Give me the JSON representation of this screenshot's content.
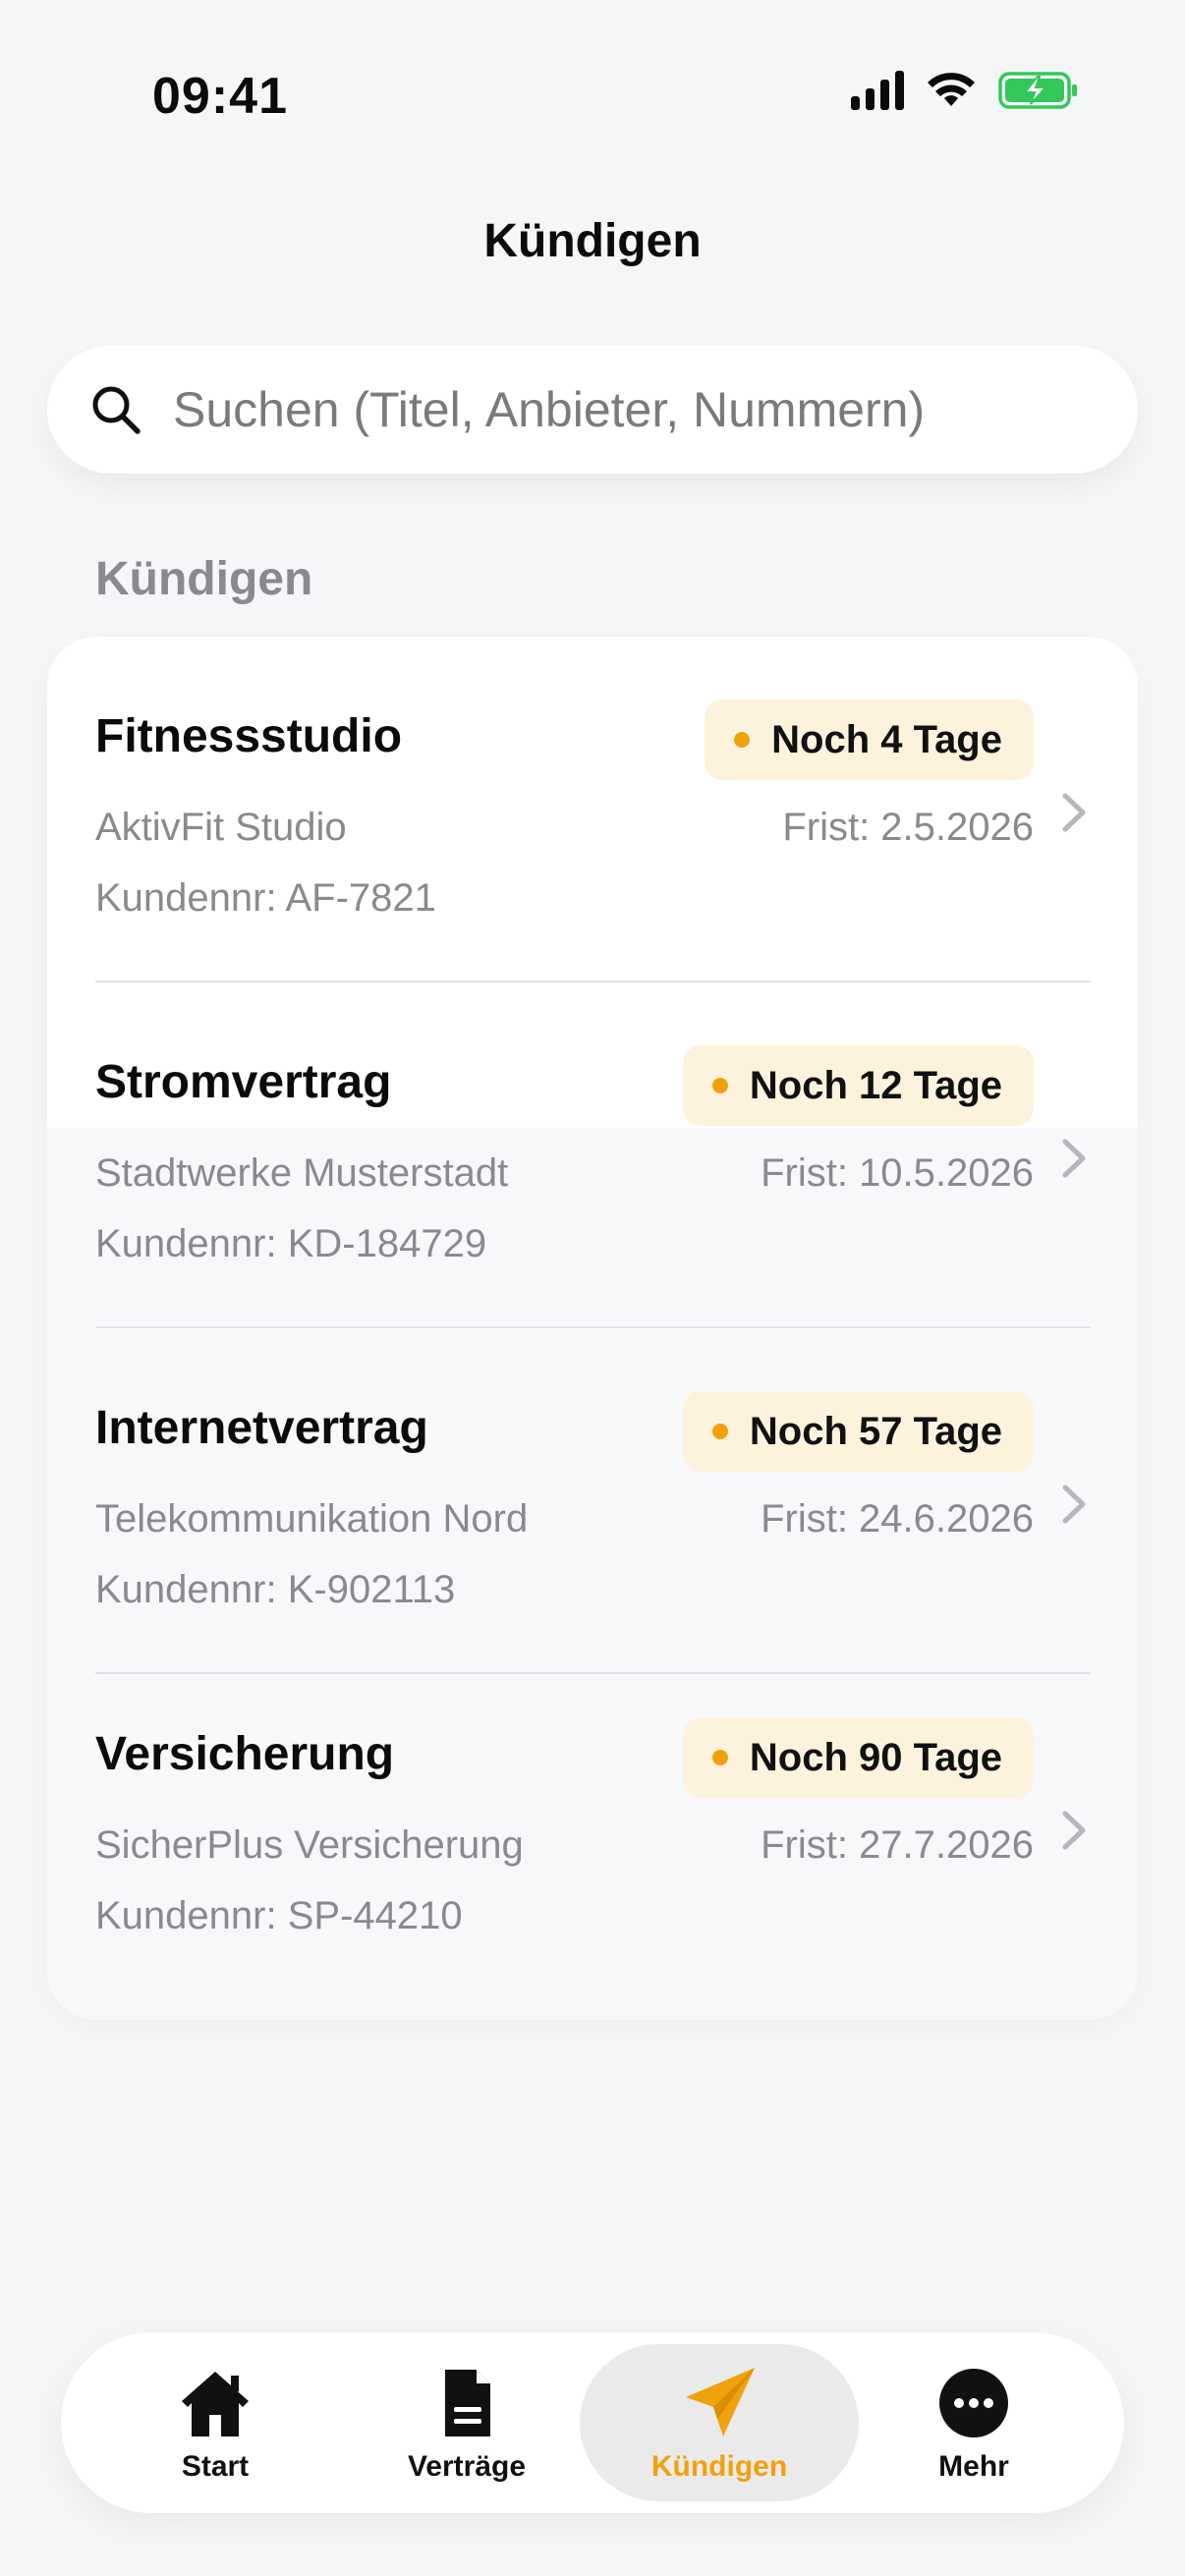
{
  "status_bar": {
    "time": "09:41"
  },
  "header": {
    "title": "Kündigen"
  },
  "search": {
    "placeholder": "Suchen (Titel, Anbieter, Nummern)"
  },
  "section": {
    "title": "Kündigen"
  },
  "contracts": [
    {
      "title": "Fitnessstudio",
      "badge": "Noch 4 Tage",
      "provider": "AktivFit Studio",
      "deadline": "Frist: 2.5.2026",
      "customer": "Kundennr: AF-7821"
    },
    {
      "title": "Stromvertrag",
      "badge": "Noch 12 Tage",
      "provider": "Stadtwerke Musterstadt",
      "deadline": "Frist: 10.5.2026",
      "customer": "Kundennr: KD-184729"
    },
    {
      "title": "Internetvertrag",
      "badge": "Noch 57 Tage",
      "provider": "Telekommunikation Nord",
      "deadline": "Frist: 24.6.2026",
      "customer": "Kundennr: K-902113"
    },
    {
      "title": "Versicherung",
      "badge": "Noch 90 Tage",
      "provider": "SicherPlus Versicherung",
      "deadline": "Frist: 27.7.2026",
      "customer": "Kundennr: SP-44210"
    }
  ],
  "tabs": [
    {
      "label": "Start",
      "icon": "home-icon"
    },
    {
      "label": "Verträge",
      "icon": "document-icon"
    },
    {
      "label": "Kündigen",
      "icon": "paper-plane-icon",
      "active": true
    },
    {
      "label": "Mehr",
      "icon": "more-icon"
    }
  ],
  "colors": {
    "accent": "#f1a10c",
    "badge_bg": "#fdf3dc",
    "battery": "#34c759",
    "background": "#f5f6f8"
  }
}
